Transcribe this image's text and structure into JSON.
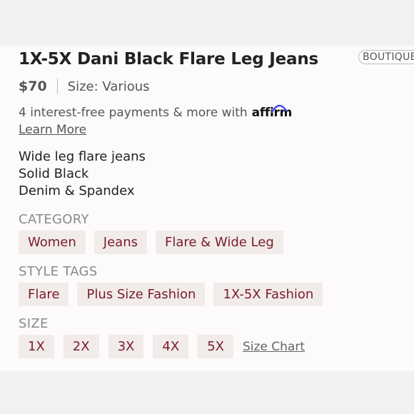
{
  "product": {
    "title": "1X-5X Dani Black Flare Leg Jeans",
    "badge": "BOUTIQUE",
    "price": "$70",
    "size_info": "Size: Various"
  },
  "payment": {
    "text": "4 interest-free payments & more with",
    "provider": "affirm",
    "learn_more": "Learn More"
  },
  "description": [
    "Wide leg flare jeans",
    "Solid Black",
    "Denim & Spandex"
  ],
  "category": {
    "label": "CATEGORY",
    "items": [
      "Women",
      "Jeans",
      "Flare & Wide Leg"
    ]
  },
  "style_tags": {
    "label": "STYLE TAGS",
    "items": [
      "Flare",
      "Plus Size Fashion",
      "1X-5X Fashion"
    ]
  },
  "size": {
    "label": "SIZE",
    "items": [
      "1X",
      "2X",
      "3X",
      "4X",
      "5X"
    ],
    "chart_link": "Size Chart"
  },
  "colors": {
    "chip_bg": "#f1ece9",
    "chip_text": "#7a1c2c",
    "affirm_blue": "#4a4af4"
  }
}
